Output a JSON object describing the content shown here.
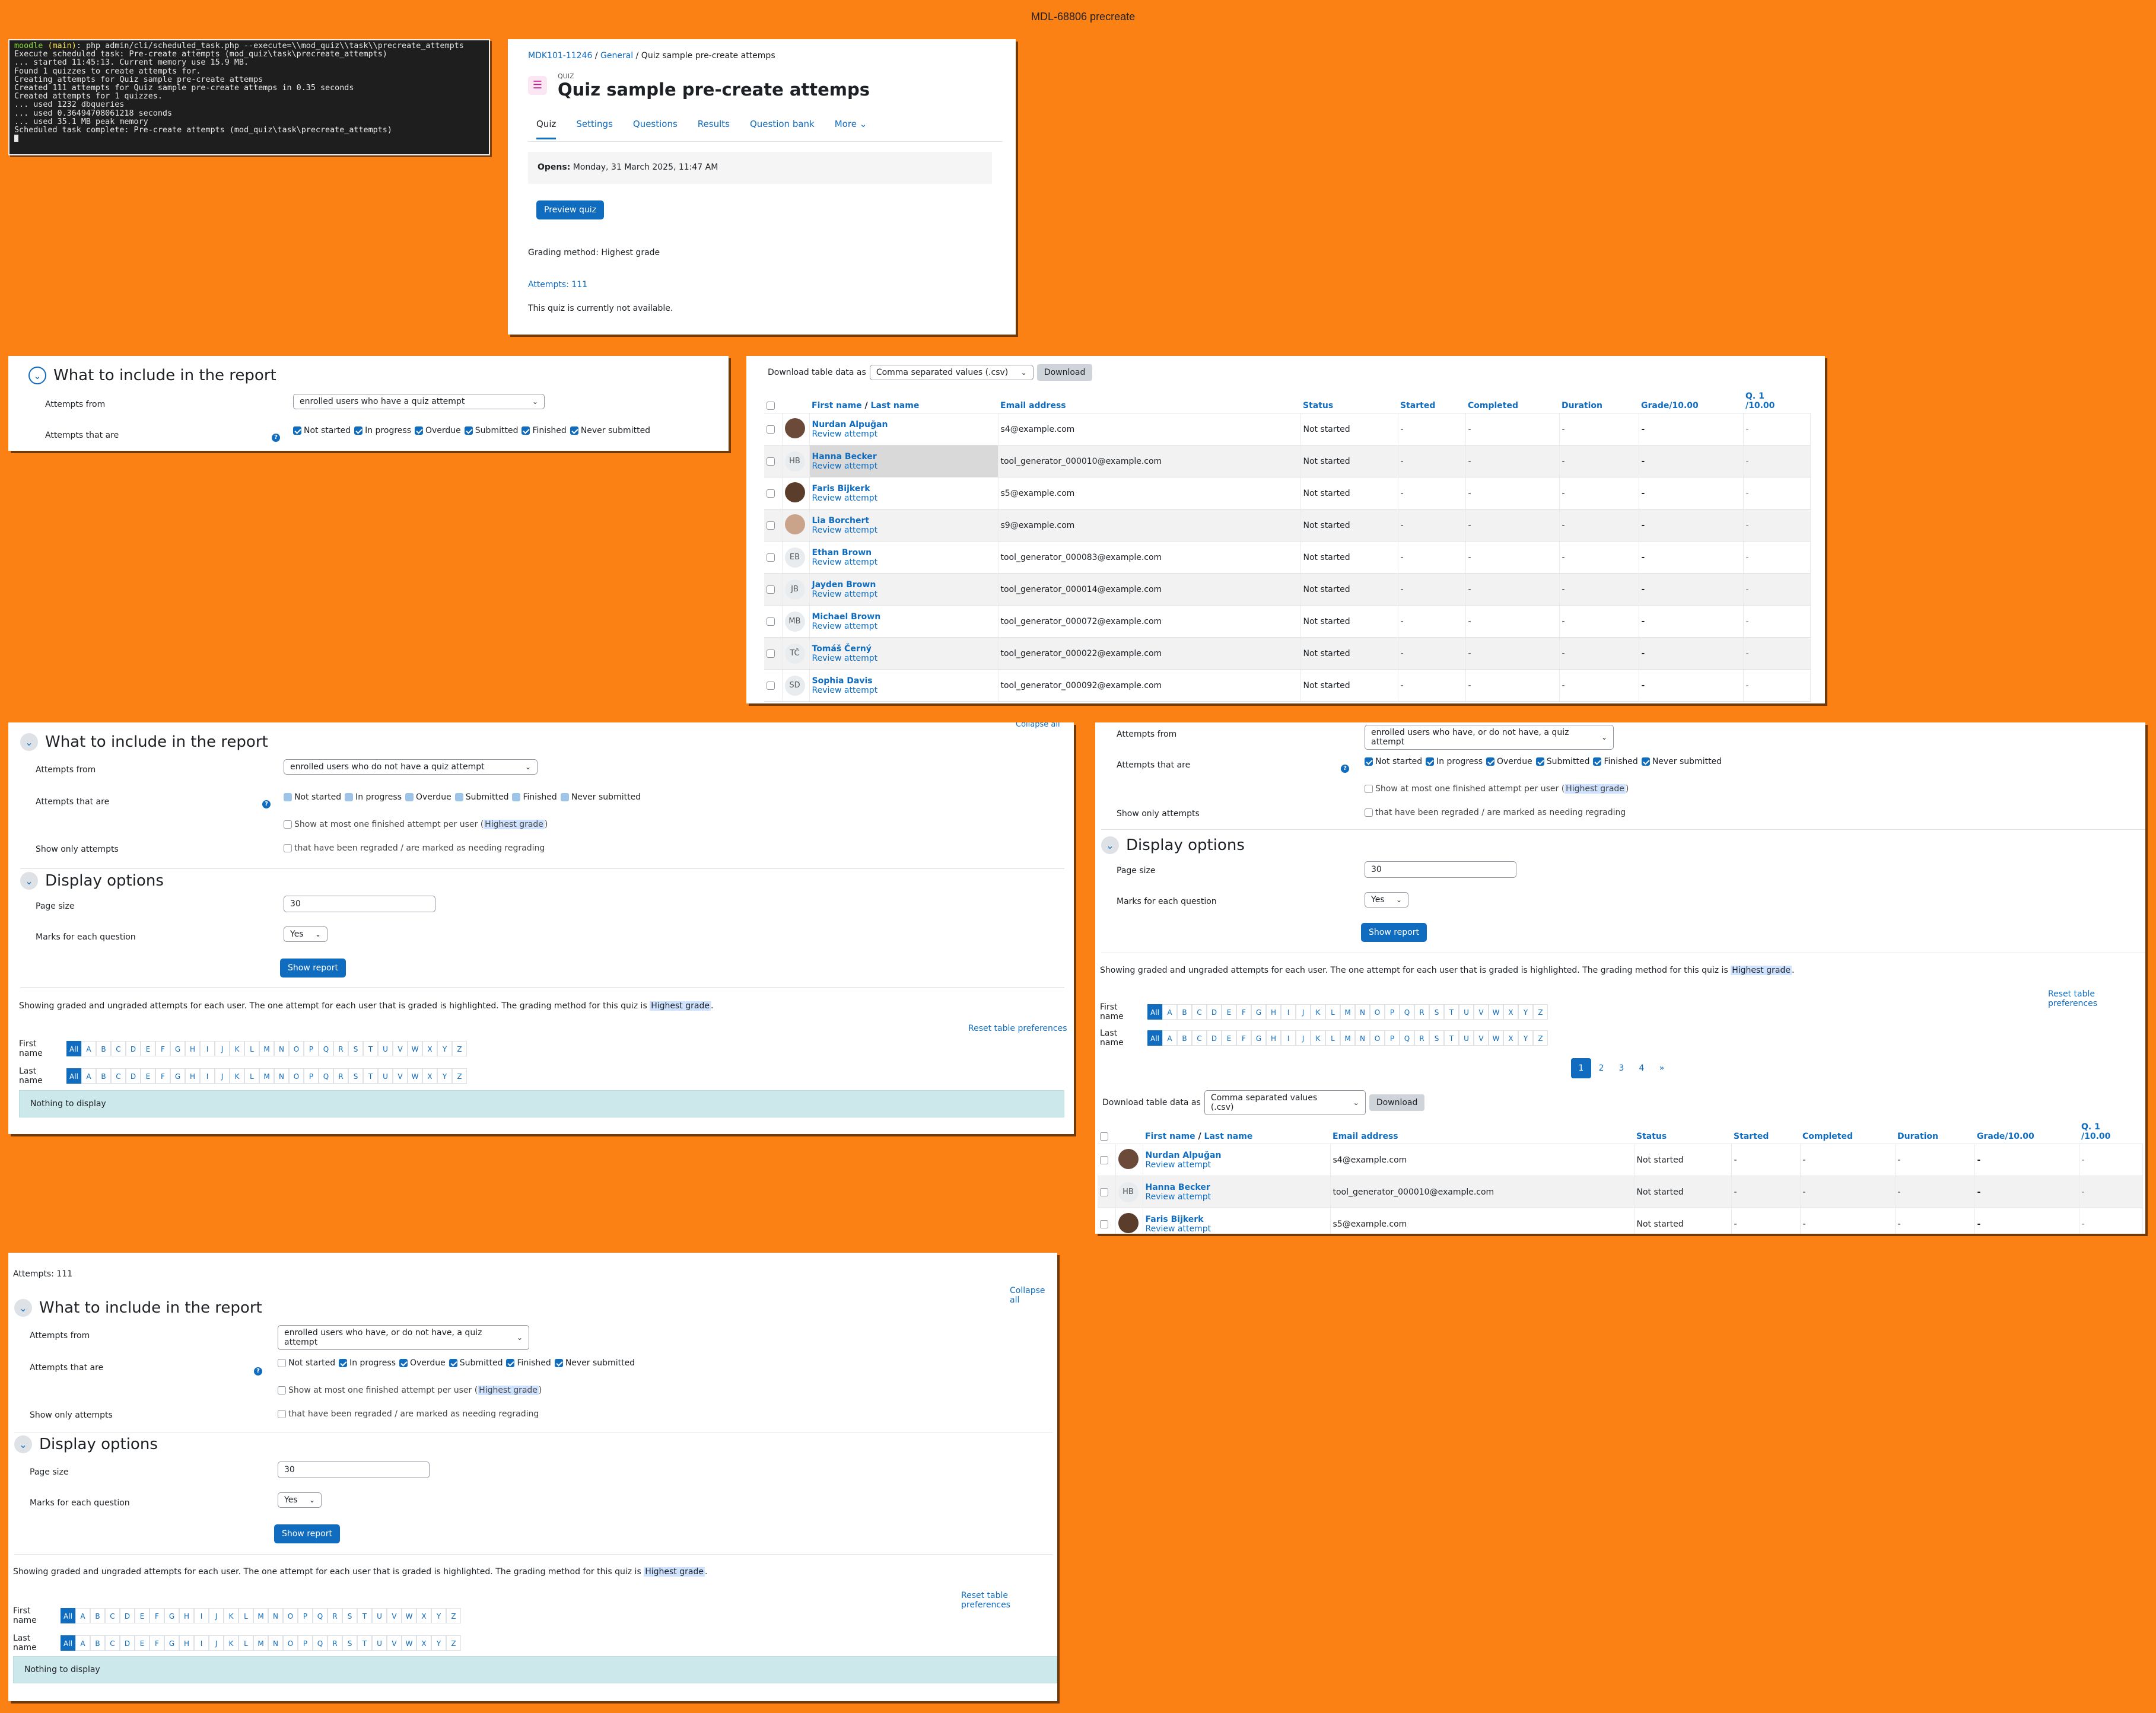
{
  "page_title": "MDL-68806 precreate",
  "terminal": {
    "prompt_dir": "moodle",
    "prompt_branch": "(main)",
    "command": "php admin/cli/scheduled_task.php --execute=\\\\mod_quiz\\\\task\\\\precreate_attempts",
    "lines": [
      "Execute scheduled task: Pre-create attempts (mod_quiz\\task\\precreate_attempts)",
      "... started 11:45:13. Current memory use 15.9 MB.",
      "Found 1 quizzes to create attempts for.",
      "Creating attempts for Quiz sample pre-create attemps",
      "Created 111 attempts for Quiz sample pre-create attemps in 0.35 seconds",
      "Created attempts for 1 quizzes.",
      "... used 1232 dbqueries",
      "... used 0.36494708061218 seconds",
      "... used 35.1 MB peak memory",
      "Scheduled task complete: Pre-create attempts (mod_quiz\\task\\precreate_attempts)"
    ]
  },
  "quiz": {
    "breadcrumb": [
      "MDK101-11246",
      "General",
      "Quiz sample pre-create attemps"
    ],
    "type": "QUIZ",
    "title": "Quiz sample pre-create attemps",
    "tabs": [
      "Quiz",
      "Settings",
      "Questions",
      "Results",
      "Question bank",
      "More ⌄"
    ],
    "opens_label": "Opens:",
    "opens_value": "Monday, 31 March 2025, 11:47 AM",
    "preview": "Preview quiz",
    "grading": "Grading method: Highest grade",
    "attempts": "Attempts: 111",
    "unavailable": "This quiz is currently not available."
  },
  "labels": {
    "what": "What to include in the report",
    "attempts_from": "Attempts from",
    "attempts_that_are": "Attempts that are",
    "show_only": "Show only attempts",
    "display": "Display options",
    "page_size": "Page size",
    "marks": "Marks for each question",
    "show_report": "Show report",
    "collapse_all": "Collapse all",
    "one_finished_pre": "Show at most one finished attempt per user (",
    "one_finished_hl": "Highest grade",
    "one_finished_post": ")",
    "regraded": "that have been regraded / are marked as needing regrading",
    "showing_pre": "Showing graded and ungraded attempts for each user. The one attempt for each user that is graded is highlighted. The grading method for this quiz is ",
    "showing_hl": "Highest grade",
    "showing_post": ".",
    "reset": "Reset table preferences",
    "first_name": "First name",
    "last_name": "Last name",
    "nothing": "Nothing to display",
    "download_label": "Download table data as",
    "download_format": "Comma separated values (.csv)",
    "download": "Download",
    "attempts_111": "Attempts: 111",
    "page_size_value": "30",
    "marks_value": "Yes"
  },
  "states": [
    "Not started",
    "In progress",
    "Overdue",
    "Submitted",
    "Finished",
    "Never submitted"
  ],
  "letters": [
    "All",
    "A",
    "B",
    "C",
    "D",
    "E",
    "F",
    "G",
    "H",
    "I",
    "J",
    "K",
    "L",
    "M",
    "N",
    "O",
    "P",
    "Q",
    "R",
    "S",
    "T",
    "U",
    "V",
    "W",
    "X",
    "Y",
    "Z"
  ],
  "from_options": {
    "p1": "enrolled users who have a quiz attempt",
    "p2": "enrolled users who do not have a quiz attempt",
    "p3": "enrolled users who have, or do not have, a quiz attempt"
  },
  "table": {
    "headers": {
      "first": "First name",
      "sep": " / ",
      "last": "Last name",
      "email": "Email address",
      "status": "Status",
      "started": "Started",
      "completed": "Completed",
      "duration": "Duration",
      "grade": "Grade/10.00",
      "q1": "Q. 1",
      "q1b": "/10.00"
    },
    "review": "Review attempt",
    "rows": [
      {
        "name": "Nurdan Alpuğan",
        "initials": "",
        "email": "s4@example.com",
        "status": "Not started"
      },
      {
        "name": "Hanna Becker",
        "initials": "HB",
        "email": "tool_generator_000010@example.com",
        "status": "Not started"
      },
      {
        "name": "Faris Bijkerk",
        "initials": "",
        "email": "s5@example.com",
        "status": "Not started"
      },
      {
        "name": "Lia Borchert",
        "initials": "",
        "email": "s9@example.com",
        "status": "Not started"
      },
      {
        "name": "Ethan Brown",
        "initials": "EB",
        "email": "tool_generator_000083@example.com",
        "status": "Not started"
      },
      {
        "name": "Jayden Brown",
        "initials": "JB",
        "email": "tool_generator_000014@example.com",
        "status": "Not started"
      },
      {
        "name": "Michael Brown",
        "initials": "MB",
        "email": "tool_generator_000072@example.com",
        "status": "Not started"
      },
      {
        "name": "Tomáš Černý",
        "initials": "TČ",
        "email": "tool_generator_000022@example.com",
        "status": "Not started"
      },
      {
        "name": "Sophia Davis",
        "initials": "SD",
        "email": "tool_generator_000092@example.com",
        "status": "Not started"
      }
    ],
    "dash": "-"
  },
  "pagination": [
    "1",
    "2",
    "3",
    "4",
    "»"
  ]
}
